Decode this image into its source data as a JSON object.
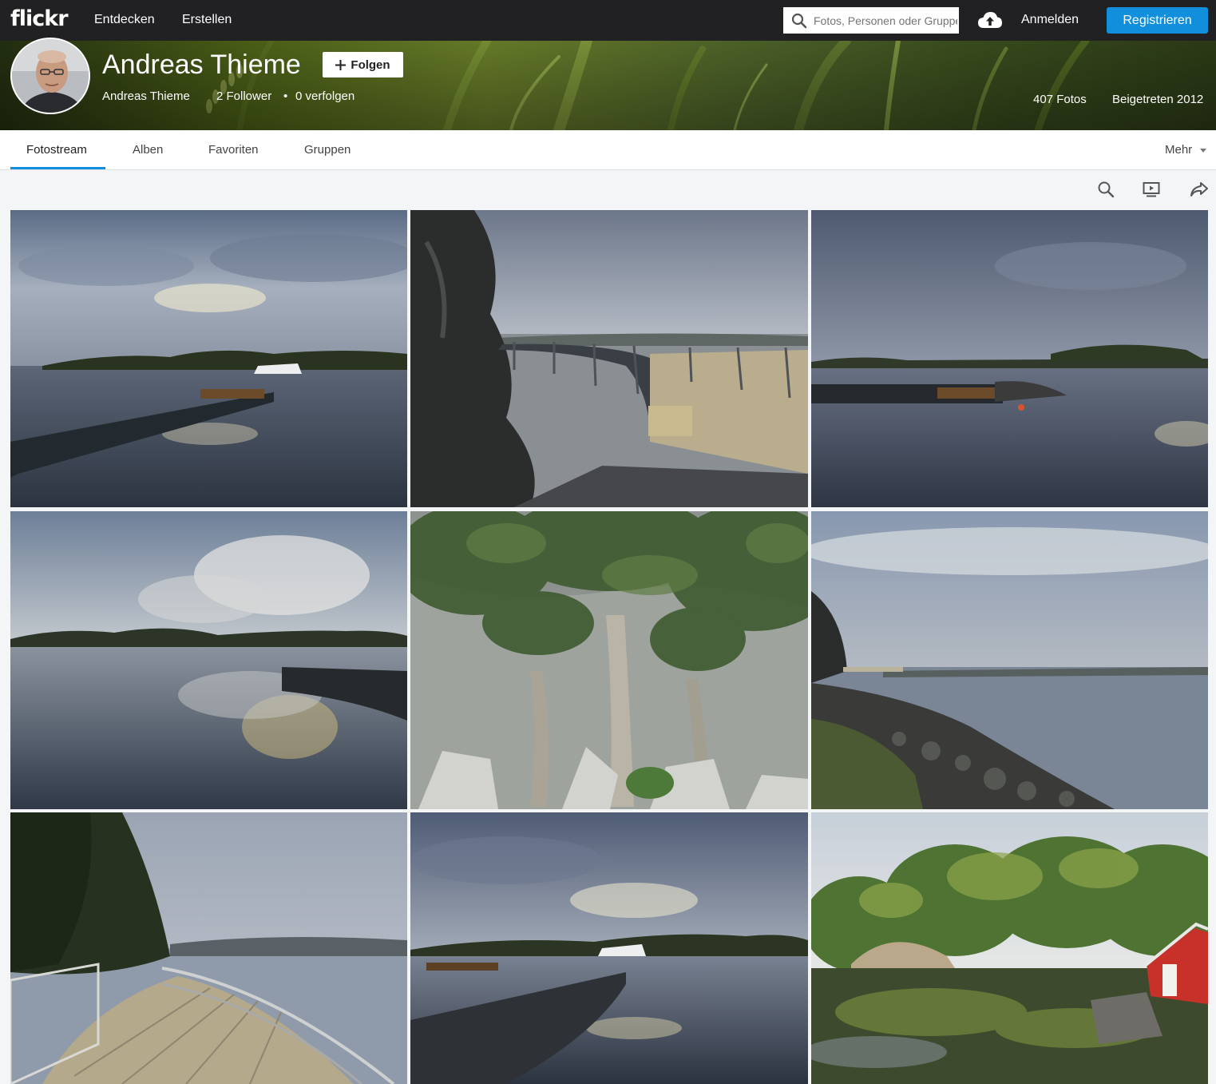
{
  "topnav": {
    "logo": "flickr",
    "links": [
      "Entdecken",
      "Erstellen"
    ],
    "search_placeholder": "Fotos, Personen oder Gruppen",
    "login": "Anmelden",
    "register": "Registrieren"
  },
  "profile": {
    "display_name": "Andreas Thieme",
    "follow_label": "Folgen",
    "real_name": "Andreas Thieme",
    "followers": "2 Follower",
    "separator": "•",
    "following": "0 verfolgen",
    "photos": "407 Fotos",
    "joined": "Beigetreten 2012"
  },
  "subnav": {
    "tabs": [
      "Fotostream",
      "Alben",
      "Favoriten",
      "Gruppen"
    ],
    "active": "Fotostream",
    "more": "Mehr"
  },
  "toolbar": {
    "icons": [
      "search-icon",
      "slideshow-icon",
      "share-icon"
    ]
  },
  "colors": {
    "accent": "#128fdc",
    "topbar": "#212124",
    "background": "#f3f5f6"
  },
  "photos": [
    {
      "subject": "harbor-pier-cloudy-reflection"
    },
    {
      "subject": "cliff-curved-walkway-bridge"
    },
    {
      "subject": "dock-boat-reflection-cloudy"
    },
    {
      "subject": "calm-lake-cloud-reflection"
    },
    {
      "subject": "trees-on-rock-face"
    },
    {
      "subject": "rocky-shore-walkway-grey-sky"
    },
    {
      "subject": "wooden-boardwalk-forest-lake"
    },
    {
      "subject": "jetty-boat-evening-reflection"
    },
    {
      "subject": "green-forest-red-boathouse"
    }
  ]
}
